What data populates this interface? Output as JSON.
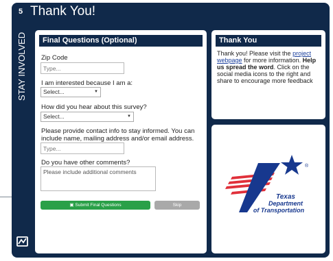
{
  "header": {
    "step_number": "5",
    "title": "Thank You!"
  },
  "sidebar": {
    "vertical_label": "STAY INVOLVED"
  },
  "form": {
    "heading": "Final Questions (Optional)",
    "zip": {
      "label": "Zip Code",
      "placeholder": "Type..."
    },
    "interest": {
      "label": "I am interested because I am a:",
      "value": "Select..."
    },
    "heard": {
      "label": "How did you hear about this survey?",
      "value": "Select..."
    },
    "contact": {
      "label": "Please provide contact info to stay informed. You can include name, mailing address and/or email address.",
      "placeholder": "Type..."
    },
    "comments": {
      "label": "Do you have other comments?",
      "placeholder": "Please include additional comments"
    },
    "submit_label": "Submit Final Questions",
    "skip_label": "Skip"
  },
  "thanks": {
    "heading": "Thank You",
    "text_before_link": "Thank you! Please visit the ",
    "link_text": "project webpage",
    "text_after_link": " for more information.",
    "bold_text": "Help us spread the word",
    "text_tail": ". Click on the social media icons to the right and share to encourage more feedback"
  },
  "logo": {
    "line1": "Texas",
    "line2": "Department",
    "line3": "of Transportation",
    "registered": "®"
  },
  "colors": {
    "navy": "#10294a",
    "submit_green": "#2aa048",
    "skip_gray": "#a9a9a9",
    "txdot_blue": "#17388e",
    "txdot_red": "#e0303a"
  },
  "icons": {
    "brand": "map-logo-icon",
    "submit": "save-icon"
  }
}
